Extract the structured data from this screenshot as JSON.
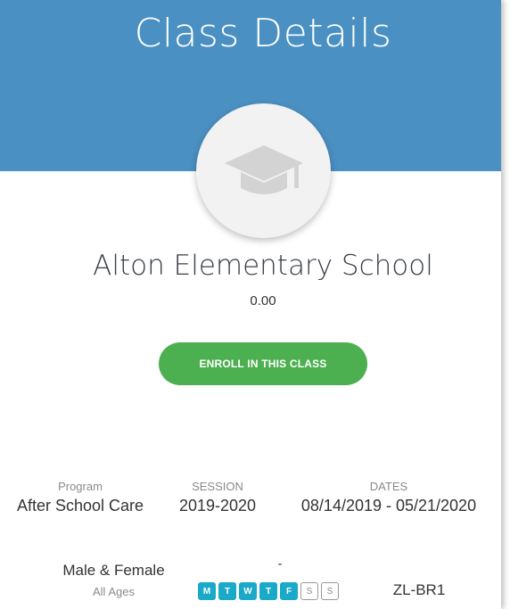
{
  "header": {
    "title": "Class Details"
  },
  "avatar": {
    "icon": "graduation-cap-icon"
  },
  "class": {
    "name": "Alton Elementary School",
    "price": "0.00"
  },
  "enroll_button": {
    "label": "ENROLL IN THIS CLASS"
  },
  "details": {
    "program": {
      "label": "Program",
      "value": "After School Care"
    },
    "session": {
      "label": "SESSION",
      "value": "2019-2020"
    },
    "dates": {
      "label": "DATES",
      "value": "08/14/2019 - 05/21/2020"
    },
    "gender": "Male & Female",
    "ages": "All Ages",
    "dash": "-",
    "code": "ZL-BR1"
  },
  "days": [
    {
      "letter": "M",
      "active": true
    },
    {
      "letter": "T",
      "active": true
    },
    {
      "letter": "W",
      "active": true
    },
    {
      "letter": "T",
      "active": true
    },
    {
      "letter": "F",
      "active": true
    },
    {
      "letter": "S",
      "active": false
    },
    {
      "letter": "S",
      "active": false
    }
  ],
  "colors": {
    "header": "#4a90c2",
    "enroll": "#4caf50",
    "day_active": "#1aa9c9"
  }
}
